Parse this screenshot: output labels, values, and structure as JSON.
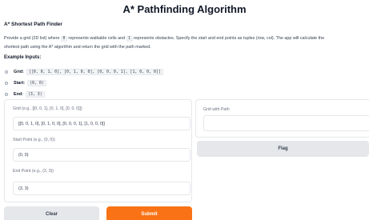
{
  "page": {
    "title": "A* Pathfinding Algorithm",
    "subtitle": "A* Shortest Path Finder"
  },
  "description": {
    "line1_a": "Provide a grid (2D list) where ",
    "code0": "0",
    "line1_b": " represents walkable cells and ",
    "code1": "1",
    "line1_c": " represents obstacles. Specify the start and end points as tuples (row, col). The app will calculate the",
    "line2": "shortest path using the A* algorithm and return the grid with the path marked."
  },
  "examples": {
    "heading": "Example Inputs:",
    "items": [
      {
        "key": "Grid:",
        "value": "[[0, 0, 1, 0], [0, 1, 0, 0], [0, 0, 0, 1], [1, 0, 0, 0]]"
      },
      {
        "key": "Start:",
        "value": "(0, 0)"
      },
      {
        "key": "End:",
        "value": "(3, 3)"
      }
    ]
  },
  "form": {
    "grid_label": "Grid (e.g., [[0, 0, 1], [0, 1, 0], [0, 0, 0]])",
    "grid_value": "[[0, 0, 1, 0], [0, 1, 0, 0], [0, 0, 0, 1], [1, 0, 0, 0]]",
    "start_label": "Start Point (e.g., (0, 0))",
    "start_value": "(0, 0)",
    "end_label": "End Point (e.g., (3, 3))",
    "end_value": "(3, 3)"
  },
  "output": {
    "label": "Grid with Path",
    "value": ""
  },
  "buttons": {
    "flag": "Flag",
    "clear": "Clear",
    "submit": "Submit"
  },
  "colors": {
    "accent": "#f97316",
    "secondary_button": "#e5e7eb"
  }
}
